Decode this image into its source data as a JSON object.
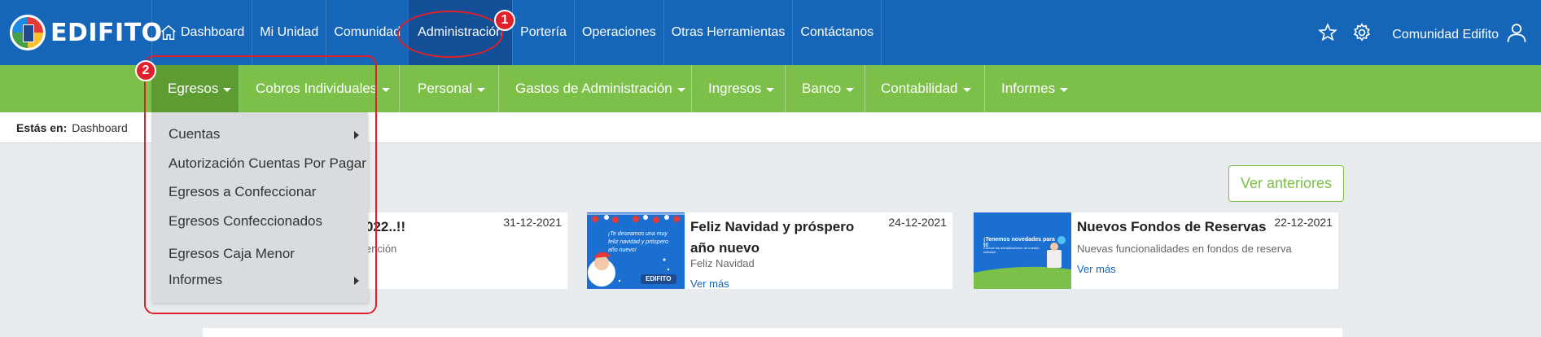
{
  "brand": {
    "name": "EDIFITO"
  },
  "topnav": {
    "items": [
      {
        "label": "Dashboard",
        "icon": "home-icon"
      },
      {
        "label": "Mi Unidad"
      },
      {
        "label": "Comunidad"
      },
      {
        "label": "Administración",
        "active": true
      },
      {
        "label": "Portería"
      },
      {
        "label": "Operaciones"
      },
      {
        "label": "Otras Herramientas"
      },
      {
        "label": "Contáctanos"
      }
    ],
    "right": {
      "favorite_icon": "star-icon",
      "settings_icon": "gear-icon",
      "user_label": "Comunidad Edifito",
      "user_icon": "user-icon"
    }
  },
  "subnav": {
    "items": [
      {
        "label": "Egresos",
        "active": true
      },
      {
        "label": "Cobros Individuales"
      },
      {
        "label": "Personal"
      },
      {
        "label": "Gastos de Administración"
      },
      {
        "label": "Ingresos"
      },
      {
        "label": "Banco"
      },
      {
        "label": "Contabilidad"
      },
      {
        "label": "Informes"
      }
    ]
  },
  "dropdown": {
    "items": [
      {
        "label": "Cuentas",
        "submenu": true
      },
      {
        "label": "Autorización Cuentas Por Pagar"
      },
      {
        "label": "Egresos a Confeccionar"
      },
      {
        "label": "Egresos Confeccionados"
      },
      {
        "label": "Egresos Caja Menor"
      },
      {
        "label": "Informes",
        "submenu": true
      }
    ]
  },
  "breadcrumb": {
    "label": "Estás en:",
    "value": "Dashboard"
  },
  "news": {
    "ver_anteriores": "Ver anteriores",
    "cards": [
      {
        "title_fragment": "022..!!",
        "date": "31-12-2021",
        "subtitle_fragment": "ención"
      },
      {
        "title": "Feliz Navidad y próspero año nuevo",
        "date": "24-12-2021",
        "subtitle": "Feliz Navidad",
        "link": "Ver más",
        "image_text": "¡Te deseamos una muy feliz navidad y próspero año nuevo!",
        "image_logo": "EDIFITO"
      },
      {
        "title": "Nuevos Fondos de Reservas",
        "date": "22-12-2021",
        "subtitle": "Nuevas funcionalidades en fondos de reserva",
        "link": "Ver más",
        "image_text": "¡Tenemos novedades para ti!",
        "image_subtext": "Conoce las actualizaciones de nuestro software"
      }
    ]
  },
  "annotations": {
    "marker_1": "1",
    "marker_2": "2",
    "color": "#e0202a"
  },
  "colors": {
    "topbar": "#1565b8",
    "topbar_active": "#124f96",
    "subnav": "#7cc04a",
    "subnav_active": "#5d9b33",
    "link": "#1565b8"
  }
}
